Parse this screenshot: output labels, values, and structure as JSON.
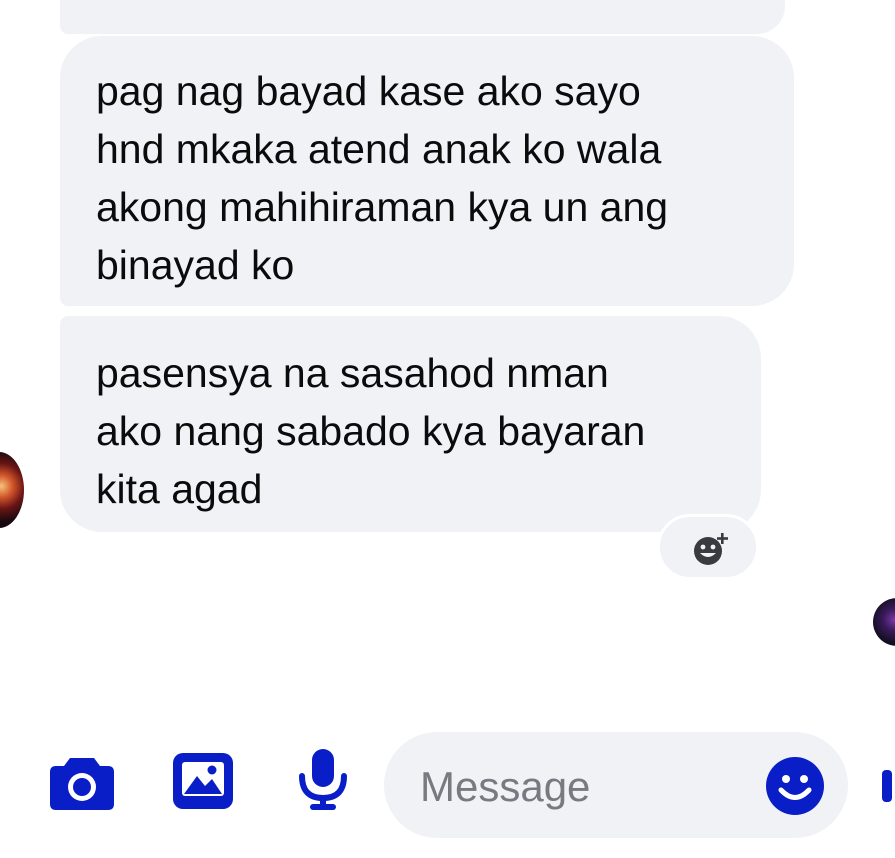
{
  "conversation": {
    "messages": [
      {
        "text": "pag nag bayad kase ako sayo\nhnd mkaka atend anak ko wala\nakong mahihiraman kya un ang\nbinayad ko"
      },
      {
        "text": "pasensya na sasahod nman\nako nang sabado kya bayaran\nkita agad"
      }
    ]
  },
  "composer": {
    "placeholder": "Message",
    "icons": [
      "camera-icon",
      "image-icon",
      "microphone-icon",
      "emoji-icon"
    ]
  },
  "colors": {
    "accent": "#0a1ec8",
    "bubble": "#f1f2f6",
    "placeholder": "#777a80",
    "text": "#0b0b0b"
  }
}
